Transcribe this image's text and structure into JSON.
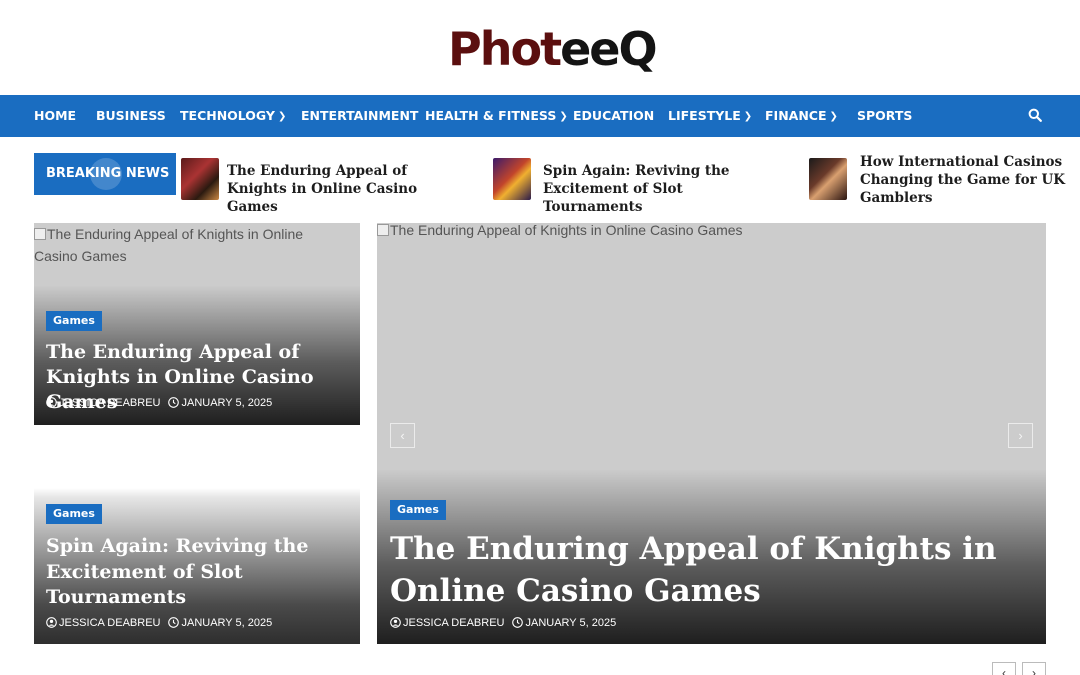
{
  "site": {
    "logo_part1": "Phot",
    "logo_part2": "eeQ"
  },
  "nav": {
    "items": [
      {
        "label": "HOME"
      },
      {
        "label": "BUSINESS"
      },
      {
        "label": "TECHNOLOGY",
        "dropdown": true
      },
      {
        "label": "ENTERTAINMENT"
      },
      {
        "label": "HEALTH & FITNESS",
        "dropdown": true
      },
      {
        "label": "EDUCATION"
      },
      {
        "label": "LIFESTYLE",
        "dropdown": true
      },
      {
        "label": "FINANCE",
        "dropdown": true
      },
      {
        "label": "SPORTS"
      }
    ],
    "search_icon": "search-icon"
  },
  "breaking": {
    "label": "BREAKING NEWS",
    "items": [
      {
        "title": "The Enduring Appeal of Knights in Online Casino Games"
      },
      {
        "title": "Spin Again: Reviving the Excitement of Slot Tournaments"
      },
      {
        "title": "How International Casinos Changing the Game for UK Gamblers"
      }
    ]
  },
  "cards": {
    "top_left": {
      "alt": "The Enduring Appeal of Knights in Online Casino Games",
      "category": "Games",
      "title": "The Enduring Appeal of Knights in Online Casino Games",
      "author": "JESSICA DEABREU",
      "date": "JANUARY 5, 2025"
    },
    "bottom_left": {
      "category": "Games",
      "title": "Spin Again: Reviving the Excitement of Slot Tournaments",
      "author": "JESSICA DEABREU",
      "date": "JANUARY 5, 2025"
    },
    "main": {
      "alt": "The Enduring Appeal of Knights in Online Casino Games",
      "category": "Games",
      "title": "The Enduring Appeal of Knights in Online Casino Games",
      "author": "JESSICA DEABREU",
      "date": "JANUARY 5, 2025"
    }
  },
  "colors": {
    "accent": "#1a6dc1",
    "logo_red": "#5b0f0f",
    "placeholder": "#cccccc"
  }
}
